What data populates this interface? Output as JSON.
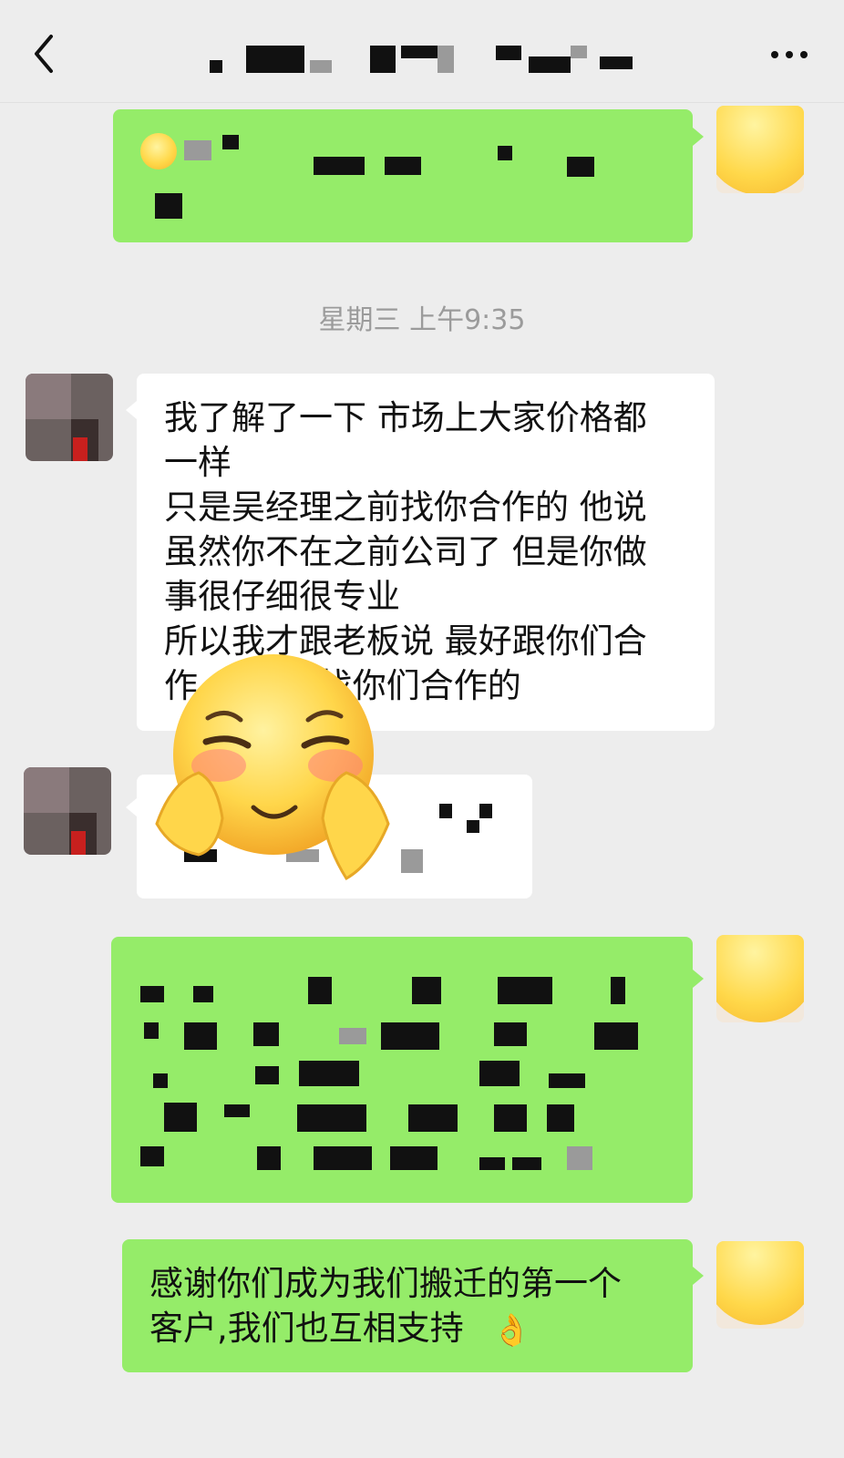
{
  "header": {
    "back_icon": "chevron-left-icon",
    "more_icon": "more-dots-icon",
    "title": ""
  },
  "timestamp": "星期三 上午9:35",
  "messages": {
    "m2_text": "我了解了一下 市场上大家价格都\n一样\n只是吴经理之前找你合作的 他说\n虽然你不在之前公司了 但是你做\n事很仔细很专业\n所以我才跟老板说 最好跟你们合\n作 ... 就是找你们合作的",
    "m5_text": "感谢你们成为我们搬迁的第一个\n客户,我们也互相支持",
    "m5_emoji": "👌"
  },
  "colors": {
    "background": "#ededed",
    "sent_bubble": "#95ec69",
    "received_bubble": "#ffffff"
  }
}
